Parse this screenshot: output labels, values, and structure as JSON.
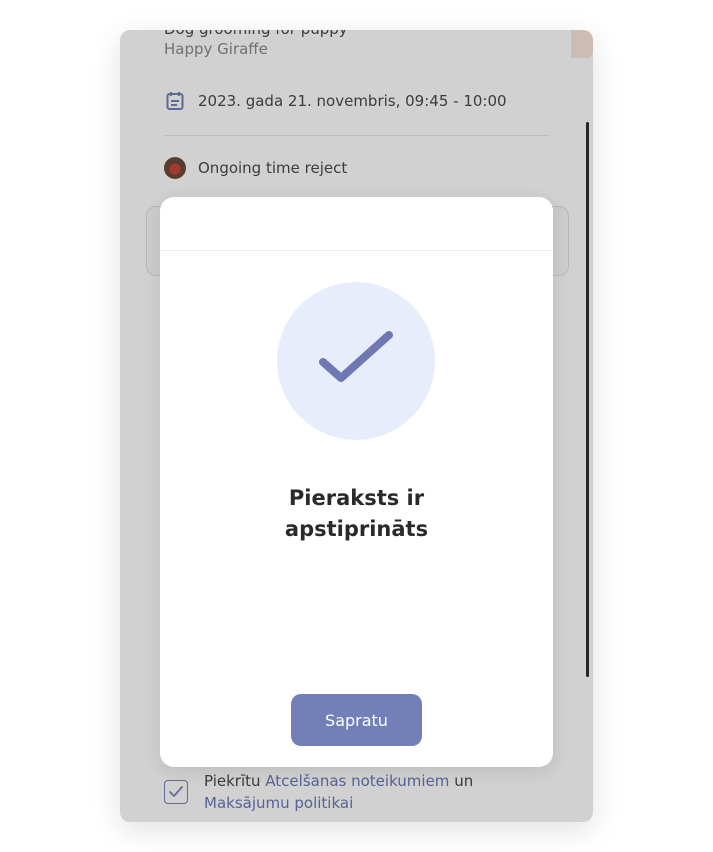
{
  "appointment": {
    "clipped_title": "Dog grooming for puppy",
    "provider": "Happy Giraffe",
    "date_time": "2023. gada 21. novembris, 09:45 - 10:00",
    "status": "Ongoing time reject"
  },
  "modal": {
    "title_line1": "Pieraksts ir",
    "title_line2": "apstiprināts",
    "confirm_label": "Sapratu"
  },
  "consent": {
    "text_before": "Piekrītu ",
    "cancellation_link": "Atcelšanas noteikumiem",
    "text_middle": " un ",
    "payment_link": "Maksājumu politikai",
    "checked": true
  },
  "colors": {
    "accent": "#7380b8",
    "check_bg": "#e8edfb",
    "peach": "#fbe6d8"
  },
  "icons": {
    "date": "calendar-icon",
    "status": "status-avatar-icon",
    "success": "checkmark-icon",
    "checkbox": "checkbox-check-icon"
  }
}
